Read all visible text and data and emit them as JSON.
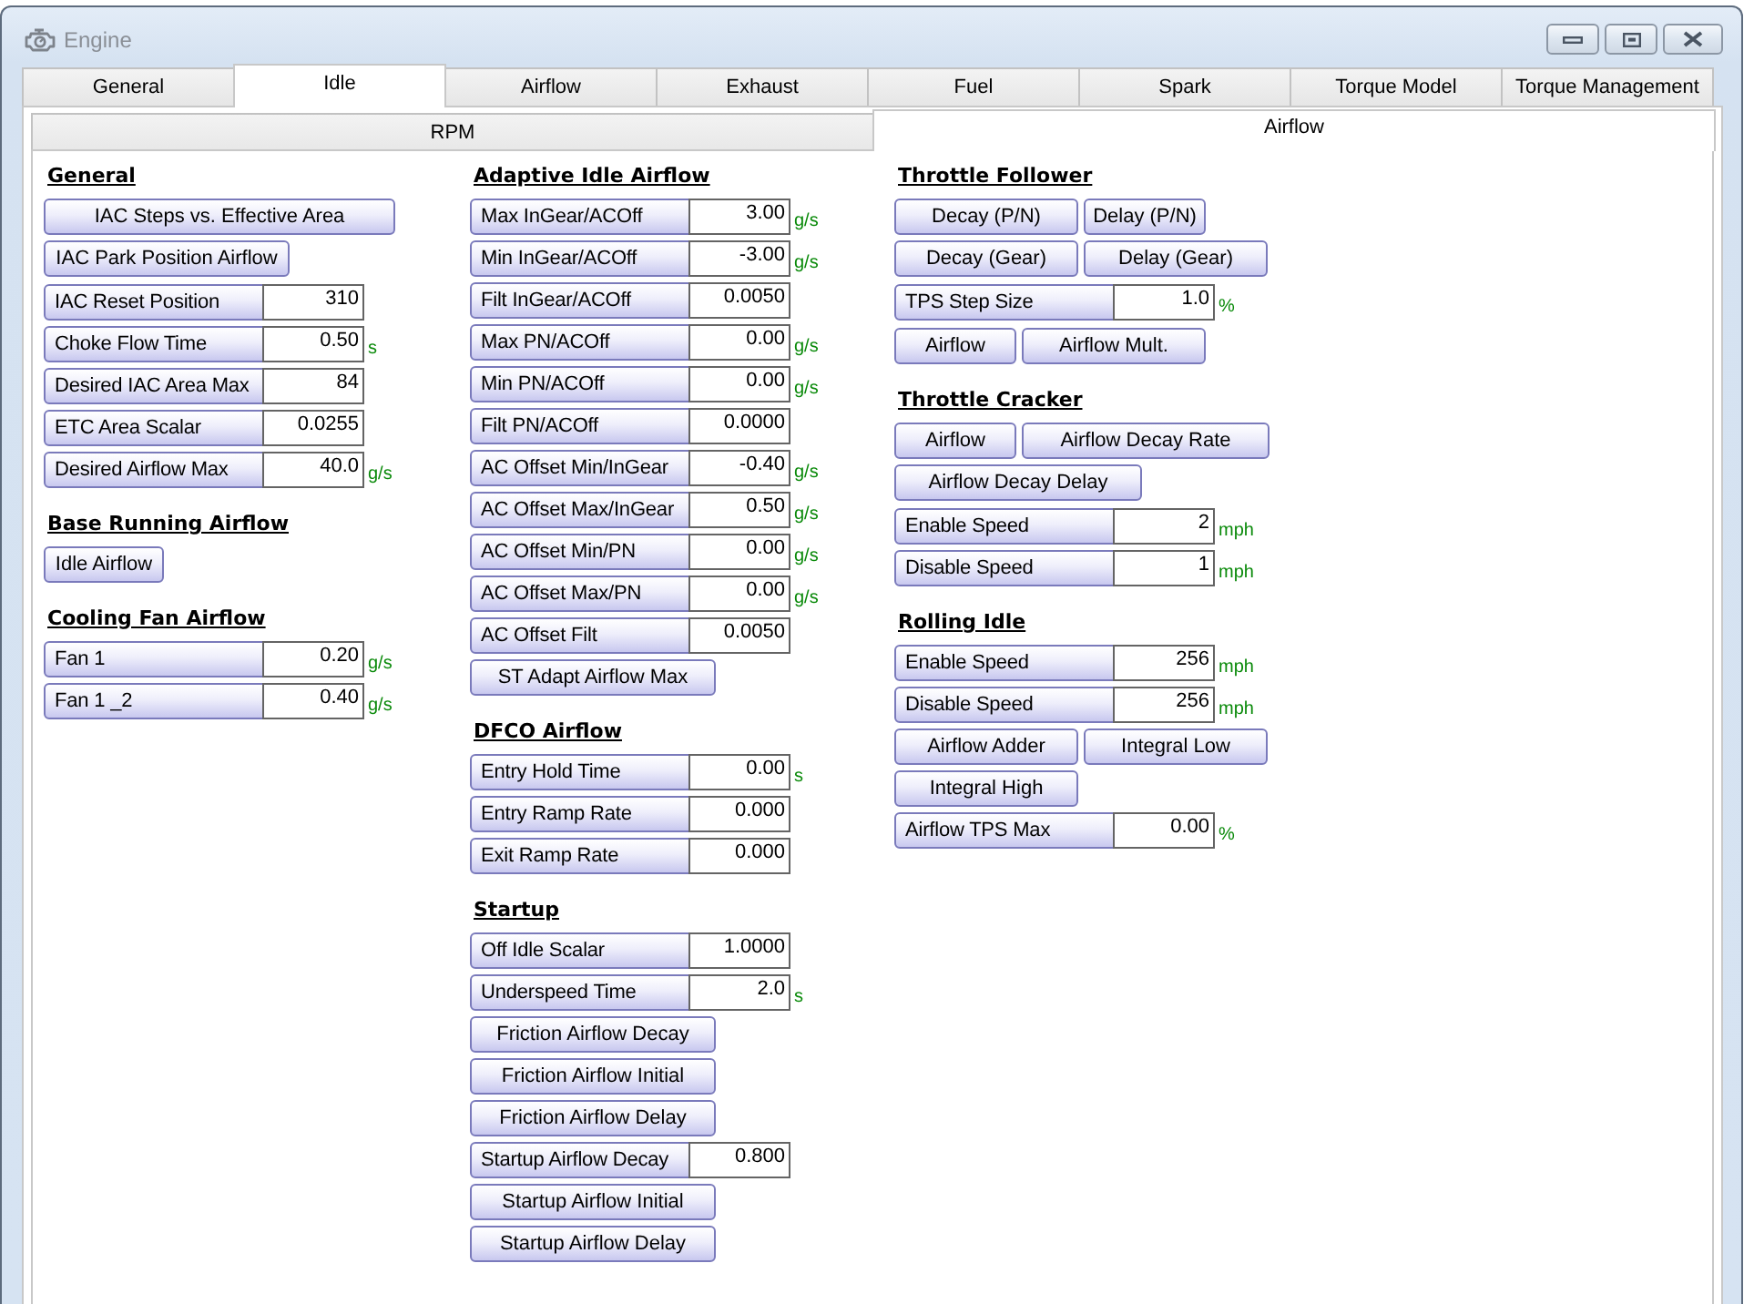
{
  "window": {
    "title": "Engine"
  },
  "tabs": [
    {
      "label": "General",
      "selected": false
    },
    {
      "label": "Idle",
      "selected": true
    },
    {
      "label": "Airflow",
      "selected": false
    },
    {
      "label": "Exhaust",
      "selected": false
    },
    {
      "label": "Fuel",
      "selected": false
    },
    {
      "label": "Spark",
      "selected": false
    },
    {
      "label": "Torque Model",
      "selected": false
    },
    {
      "label": "Torque Management",
      "selected": false
    }
  ],
  "subtabs": [
    {
      "label": "RPM",
      "selected": false
    },
    {
      "label": "Airflow",
      "selected": true
    }
  ],
  "columns": [
    {
      "sections": [
        {
          "heading": "General",
          "groups": [
            {
              "rows": [
                {
                  "kind": "buttons",
                  "buttons": [
                    "IAC Steps vs. Effective Area"
                  ]
                },
                {
                  "kind": "buttons",
                  "buttons": [
                    "IAC Park Position Airflow"
                  ]
                }
              ]
            },
            {
              "rows": [
                {
                  "kind": "field",
                  "label": "IAC Reset Position",
                  "value": "310"
                },
                {
                  "kind": "field",
                  "label": "Choke Flow Time",
                  "value": "0.50",
                  "unit": "s"
                },
                {
                  "kind": "field",
                  "label": "Desired IAC Area Max",
                  "value": "84"
                },
                {
                  "kind": "field",
                  "label": "ETC Area Scalar",
                  "value": "0.0255"
                },
                {
                  "kind": "field",
                  "label": "Desired Airflow Max",
                  "value": "40.0",
                  "unit": "g/s"
                }
              ]
            }
          ]
        },
        {
          "heading": "Base Running Airflow",
          "groups": [
            {
              "rows": [
                {
                  "kind": "buttons",
                  "buttons": [
                    "Idle Airflow"
                  ]
                }
              ]
            }
          ]
        },
        {
          "heading": "Cooling Fan Airflow",
          "groups": [
            {
              "rows": [
                {
                  "kind": "field",
                  "label": "Fan 1",
                  "value": "0.20",
                  "unit": "g/s"
                },
                {
                  "kind": "field",
                  "label": "Fan 1 _2",
                  "value": "0.40",
                  "unit": "g/s"
                }
              ]
            }
          ]
        }
      ]
    },
    {
      "sections": [
        {
          "heading": "Adaptive Idle Airflow",
          "groups": [
            {
              "rows": [
                {
                  "kind": "field",
                  "label": "Max InGear/ACOff",
                  "value": "3.00",
                  "unit": "g/s"
                },
                {
                  "kind": "field",
                  "label": "Min InGear/ACOff",
                  "value": "-3.00",
                  "unit": "g/s"
                },
                {
                  "kind": "field",
                  "label": "Filt InGear/ACOff",
                  "value": "0.0050"
                },
                {
                  "kind": "field",
                  "label": "Max PN/ACOff",
                  "value": "0.00",
                  "unit": "g/s"
                },
                {
                  "kind": "field",
                  "label": "Min PN/ACOff",
                  "value": "0.00",
                  "unit": "g/s"
                },
                {
                  "kind": "field",
                  "label": "Filt PN/ACOff",
                  "value": "0.0000"
                },
                {
                  "kind": "field",
                  "label": "AC Offset Min/InGear",
                  "value": "-0.40",
                  "unit": "g/s"
                },
                {
                  "kind": "field",
                  "label": "AC Offset Max/InGear",
                  "value": "0.50",
                  "unit": "g/s"
                },
                {
                  "kind": "field",
                  "label": "AC Offset Min/PN",
                  "value": "0.00",
                  "unit": "g/s"
                },
                {
                  "kind": "field",
                  "label": "AC Offset Max/PN",
                  "value": "0.00",
                  "unit": "g/s"
                },
                {
                  "kind": "field",
                  "label": "AC Offset Filt",
                  "value": "0.0050"
                },
                {
                  "kind": "buttons",
                  "buttons": [
                    "ST Adapt Airflow Max"
                  ]
                }
              ]
            }
          ]
        },
        {
          "heading": "DFCO Airflow",
          "groups": [
            {
              "rows": [
                {
                  "kind": "field",
                  "label": "Entry Hold Time",
                  "value": "0.00",
                  "unit": "s"
                },
                {
                  "kind": "field",
                  "label": "Entry Ramp Rate",
                  "value": "0.000"
                },
                {
                  "kind": "field",
                  "label": "Exit Ramp Rate",
                  "value": "0.000"
                }
              ]
            }
          ]
        },
        {
          "heading": "Startup",
          "groups": [
            {
              "rows": [
                {
                  "kind": "field",
                  "label": "Off Idle Scalar",
                  "value": "1.0000"
                },
                {
                  "kind": "field",
                  "label": "Underspeed Time",
                  "value": "2.0",
                  "unit": "s"
                },
                {
                  "kind": "buttons",
                  "buttons": [
                    "Friction Airflow Decay"
                  ]
                },
                {
                  "kind": "buttons",
                  "buttons": [
                    "Friction Airflow Initial"
                  ]
                },
                {
                  "kind": "buttons",
                  "buttons": [
                    "Friction Airflow Delay"
                  ]
                },
                {
                  "kind": "field",
                  "label": "Startup Airflow Decay",
                  "value": "0.800"
                },
                {
                  "kind": "buttons",
                  "buttons": [
                    "Startup Airflow Initial"
                  ]
                },
                {
                  "kind": "buttons",
                  "buttons": [
                    "Startup Airflow Delay"
                  ]
                }
              ]
            }
          ]
        }
      ]
    },
    {
      "sections": [
        {
          "heading": "Throttle Follower",
          "groups": [
            {
              "rows": [
                {
                  "kind": "buttons",
                  "buttons": [
                    "Decay (P/N)",
                    "Delay (P/N)"
                  ]
                },
                {
                  "kind": "buttons",
                  "buttons": [
                    "Decay (Gear)",
                    "Delay (Gear)"
                  ]
                }
              ]
            },
            {
              "rows": [
                {
                  "kind": "field",
                  "label": "TPS Step Size",
                  "value": "1.0",
                  "unit": "%"
                }
              ]
            },
            {
              "rows": [
                {
                  "kind": "buttons",
                  "buttons": [
                    "Airflow",
                    "Airflow Mult."
                  ]
                }
              ]
            }
          ]
        },
        {
          "heading": "Throttle Cracker",
          "groups": [
            {
              "rows": [
                {
                  "kind": "buttons",
                  "buttons": [
                    "Airflow",
                    "Airflow Decay Rate"
                  ]
                },
                {
                  "kind": "buttons",
                  "buttons": [
                    "Airflow Decay Delay"
                  ]
                }
              ]
            },
            {
              "rows": [
                {
                  "kind": "field",
                  "label": "Enable Speed",
                  "value": "2",
                  "unit": "mph"
                },
                {
                  "kind": "field",
                  "label": "Disable Speed",
                  "value": "1",
                  "unit": "mph"
                }
              ]
            }
          ]
        },
        {
          "heading": "Rolling Idle",
          "groups": [
            {
              "rows": [
                {
                  "kind": "field",
                  "label": "Enable Speed",
                  "value": "256",
                  "unit": "mph"
                },
                {
                  "kind": "field",
                  "label": "Disable Speed",
                  "value": "256",
                  "unit": "mph"
                },
                {
                  "kind": "buttons",
                  "buttons": [
                    "Airflow Adder",
                    "Integral Low"
                  ]
                },
                {
                  "kind": "buttons",
                  "buttons": [
                    "Integral High"
                  ]
                },
                {
                  "kind": "field",
                  "label": "Airflow TPS Max",
                  "value": "0.00",
                  "unit": "%"
                }
              ]
            }
          ]
        }
      ]
    }
  ]
}
